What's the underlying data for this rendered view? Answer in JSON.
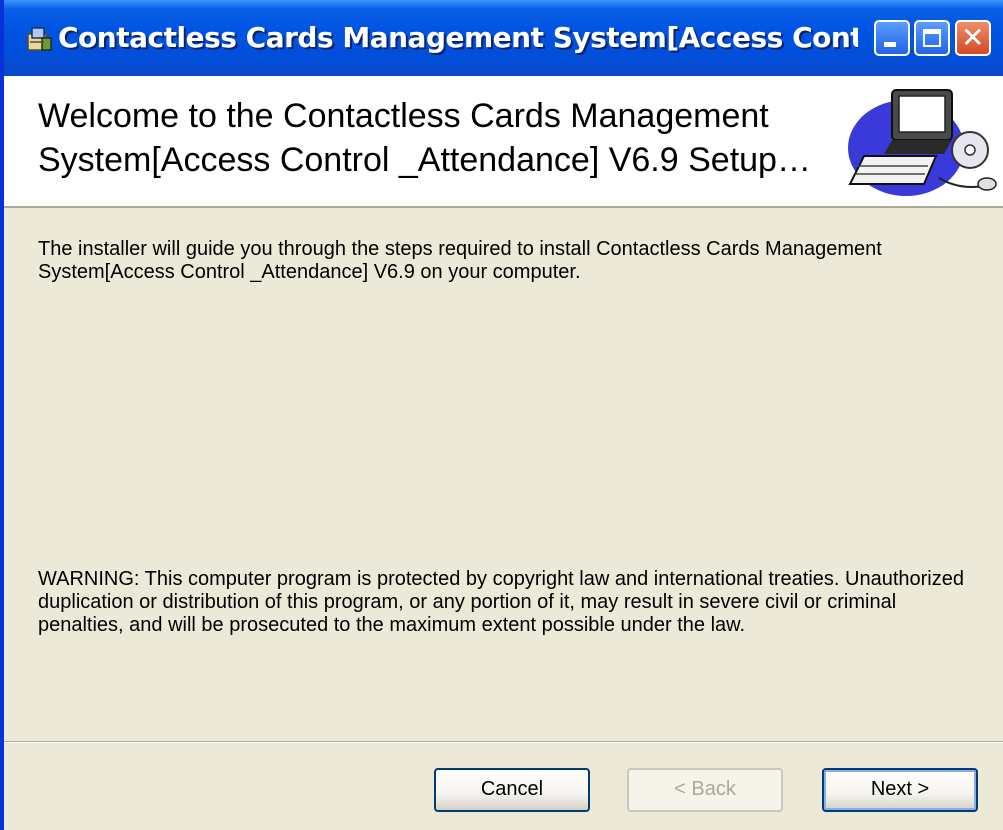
{
  "window": {
    "title": "Contactless Cards Management System[Access Control & Atten…",
    "controls": {
      "minimize_icon": "minimize-icon",
      "maximize_icon": "maximize-icon",
      "close_icon": "close-icon",
      "close_glyph": "✕"
    },
    "colors": {
      "titlebar": "#0054e3",
      "close_button": "#d24a25",
      "dialog_background": "#ece9d8"
    }
  },
  "banner": {
    "title": "Welcome to the Contactless Cards Management System[Access Control _Attendance] V6.9 Setup…"
  },
  "content": {
    "intro": "The installer will guide you through the steps required to install Contactless Cards Management System[Access Control _Attendance] V6.9 on your computer.",
    "warning": "WARNING: This computer program is protected by copyright law and international treaties. Unauthorized duplication or distribution of this program, or any portion of it, may result in severe civil or criminal penalties, and will be prosecuted to the maximum extent possible under the law."
  },
  "buttons": {
    "cancel": "Cancel",
    "back": "< Back",
    "next": "Next >"
  }
}
